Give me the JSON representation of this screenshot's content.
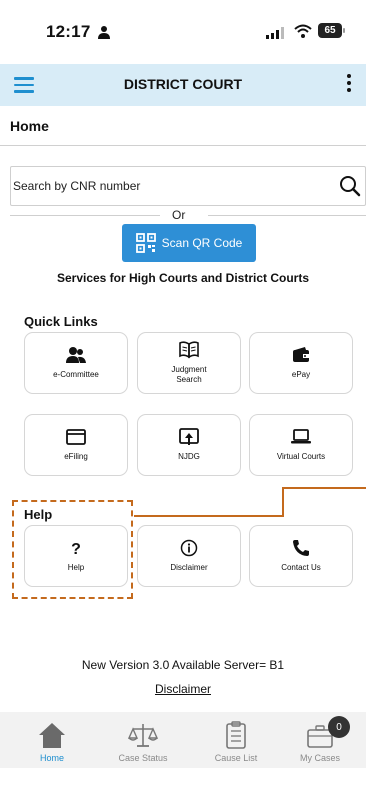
{
  "status_bar": {
    "time": "12:17",
    "battery": "65"
  },
  "app_bar": {
    "title": "DISTRICT COURT"
  },
  "page": {
    "title": "Home"
  },
  "search": {
    "placeholder": "Search by CNR number"
  },
  "divider_text": "Or",
  "qr_button": {
    "label": "Scan QR Code"
  },
  "services_text": "Services for High Courts and District Courts",
  "quick_links": {
    "title": "Quick Links",
    "items": [
      {
        "label": "e-Committee",
        "icon": "people-icon"
      },
      {
        "label": "Judgment Search",
        "icon": "book-icon"
      },
      {
        "label": "ePay",
        "icon": "wallet-icon"
      },
      {
        "label": "eFiling",
        "icon": "browser-window-icon"
      },
      {
        "label": "NJDG",
        "icon": "upload-box-icon"
      },
      {
        "label": "Virtual Courts",
        "icon": "laptop-icon"
      }
    ]
  },
  "help": {
    "title": "Help",
    "items": [
      {
        "label": "Help",
        "icon": "question-icon"
      },
      {
        "label": "Disclaimer",
        "icon": "info-icon"
      },
      {
        "label": "Contact Us",
        "icon": "phone-icon"
      }
    ]
  },
  "footer": {
    "version_text": "New Version 3.0 Available Server= B1",
    "disclaimer_link": "Disclaimer"
  },
  "bottom_nav": {
    "items": [
      {
        "label": "Home",
        "icon": "home-icon",
        "active": true
      },
      {
        "label": "Case Status",
        "icon": "scales-icon"
      },
      {
        "label": "Cause List",
        "icon": "clipboard-icon"
      },
      {
        "label": "My Cases",
        "icon": "briefcase-icon",
        "badge": "0"
      }
    ]
  },
  "colors": {
    "accent": "#1f8fcf",
    "app_bar_bg": "#d8ecf7",
    "highlight": "#c46a1d",
    "qr_button": "#2e8fd6"
  }
}
